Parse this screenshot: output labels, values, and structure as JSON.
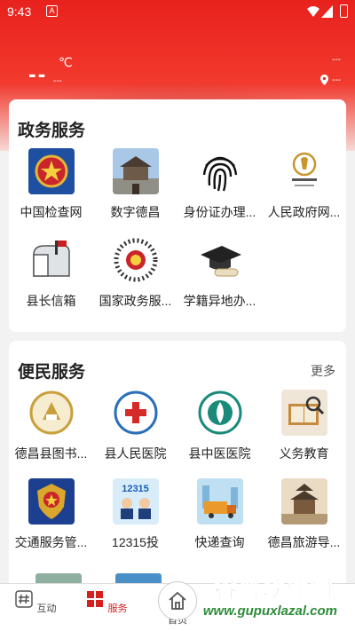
{
  "status": {
    "time": "9:43",
    "notif_glyph": "A"
  },
  "weather": {
    "temp": "--",
    "unit": "℃",
    "sub": "---",
    "right_top": "---",
    "location": "---"
  },
  "gov": {
    "title": "政务服务",
    "items": [
      {
        "label": "中国检查网",
        "icon": "procuratorate-emblem-icon"
      },
      {
        "label": "数字德昌",
        "icon": "city-gate-icon"
      },
      {
        "label": "身份证办理...",
        "icon": "fingerprint-icon"
      },
      {
        "label": "人民政府网...",
        "icon": "dechang-logo-icon"
      },
      {
        "label": "县长信箱",
        "icon": "mailbox-icon"
      },
      {
        "label": "国家政务服...",
        "icon": "qr-code-icon"
      },
      {
        "label": "学籍异地办...",
        "icon": "graduation-cap-icon"
      }
    ]
  },
  "convenience": {
    "title": "便民服务",
    "more": "更多",
    "items": [
      {
        "label": "德昌县图书...",
        "icon": "library-logo-icon"
      },
      {
        "label": "县人民医院",
        "icon": "hospital-logo-icon"
      },
      {
        "label": "县中医医院",
        "icon": "tcm-hospital-logo-icon"
      },
      {
        "label": "义务教育",
        "icon": "book-search-icon"
      },
      {
        "label": "交通服务管...",
        "icon": "police-emblem-icon"
      },
      {
        "label": "12315投",
        "icon": "12315-poster-icon",
        "poster_text": "12315"
      },
      {
        "label": "快递查询",
        "icon": "delivery-truck-icon"
      },
      {
        "label": "德昌旅游导...",
        "icon": "tourism-tower-icon"
      }
    ]
  },
  "tabs": [
    {
      "label": "互动",
      "icon": "hash-icon"
    },
    {
      "label": "服务",
      "icon": "grid-icon",
      "active": true
    },
    {
      "label": "首页",
      "icon": "home-icon"
    }
  ],
  "watermark": {
    "main": "谷普软件园",
    "sub": "www.gupuxlazal.com"
  },
  "colors": {
    "brand_red": "#e8211d",
    "active_tab": "#d61f1f",
    "watermark_green": "#2e8b3a"
  }
}
